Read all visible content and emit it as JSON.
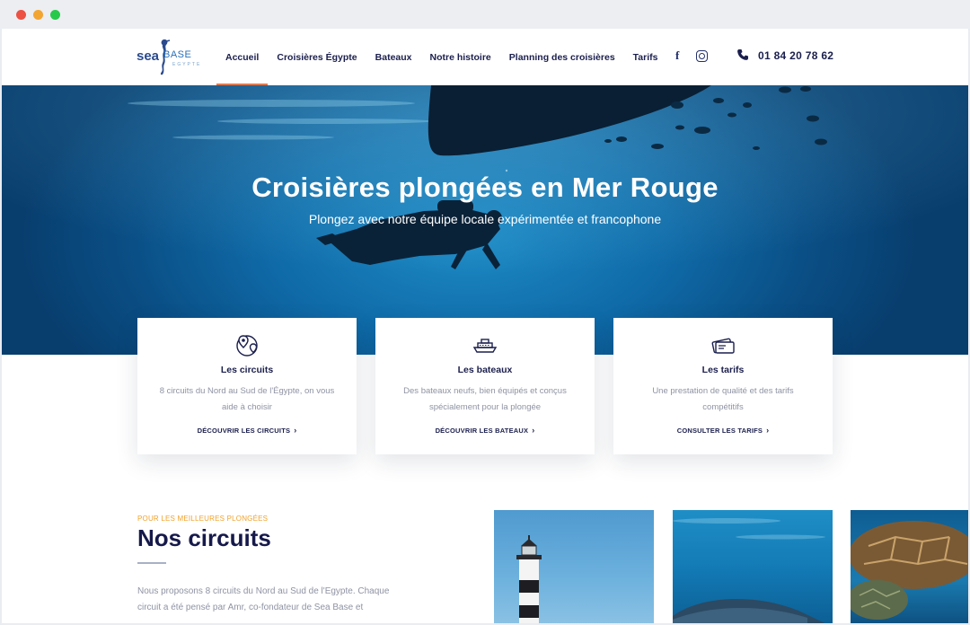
{
  "header": {
    "logo": {
      "word1": "sea",
      "word2": "BASE",
      "sub": "EGYPTE"
    },
    "nav": [
      {
        "label": "Accueil"
      },
      {
        "label": "Croisières Égypte"
      },
      {
        "label": "Bateaux"
      },
      {
        "label": "Notre histoire"
      },
      {
        "label": "Planning des croisières"
      },
      {
        "label": "Tarifs"
      }
    ],
    "social": [
      "facebook-icon",
      "instagram-icon"
    ],
    "phone": "01 84 20 78 62"
  },
  "hero": {
    "title": "Croisières plongées en Mer Rouge",
    "subtitle": "Plongez avec notre équipe locale expérimentée et francophone"
  },
  "cards": [
    {
      "icon": "map-pins-icon",
      "title": "Les circuits",
      "text": "8 circuits du Nord au Sud de l'Égypte, on vous aide à choisir",
      "cta": "DÉCOUVRIR LES CIRCUITS"
    },
    {
      "icon": "boat-icon",
      "title": "Les bateaux",
      "text": "Des bateaux neufs, bien équipés et conçus spécialement pour la plongée",
      "cta": "DÉCOUVRIR LES BATEAUX"
    },
    {
      "icon": "price-tag-icon",
      "title": "Les tarifs",
      "text": "Une prestation de qualité et des tarifs compétitifs",
      "cta": "CONSULTER LES TARIFS"
    }
  ],
  "circuits": {
    "eyebrow": "POUR LES MEILLEURES PLONGÉES",
    "title": "Nos circuits",
    "text": "Nous proposons 8 circuits du Nord au Sud de l'Egypte. Chaque circuit a été pensé par Amr, co-fondateur de Sea Base et"
  },
  "colors": {
    "accent_orange": "#f0a22c",
    "nav_underline": "#e07a4f",
    "navy": "#1b1f4d"
  }
}
